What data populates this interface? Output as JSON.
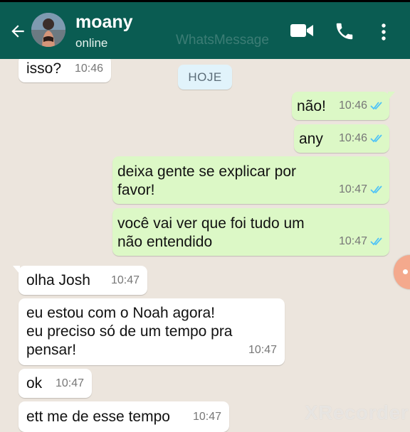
{
  "header": {
    "contact_name": "moany",
    "status": "online",
    "watermark": "WhatsMessage"
  },
  "date_label": "HOJE",
  "messages": [
    {
      "text": "isso?",
      "time": "10:46",
      "direction": "incoming"
    },
    {
      "text": "não!",
      "time": "10:46",
      "direction": "outgoing",
      "read": true
    },
    {
      "text": "any",
      "time": "10:46",
      "direction": "outgoing",
      "read": true
    },
    {
      "text": "deixa gente se explicar por favor!",
      "time": "10:47",
      "direction": "outgoing",
      "read": true
    },
    {
      "text": "você vai ver que foi tudo um não entendido",
      "time": "10:47",
      "direction": "outgoing",
      "read": true
    },
    {
      "text": "olha Josh",
      "time": "10:47",
      "direction": "incoming"
    },
    {
      "text": "eu estou com o Noah agora! eu preciso só de um tempo pra pensar!",
      "time": "10:47",
      "direction": "incoming"
    },
    {
      "text": "ok",
      "time": "10:47",
      "direction": "incoming"
    },
    {
      "text": "ett me de esse tempo",
      "time": "10:47",
      "direction": "incoming"
    }
  ],
  "recorder_watermark": "XRecorder",
  "colors": {
    "header": "#0a5c52",
    "incoming_bubble": "#ffffff",
    "outgoing_bubble": "#dcf8c6",
    "read_ticks": "#4fc3f7"
  }
}
